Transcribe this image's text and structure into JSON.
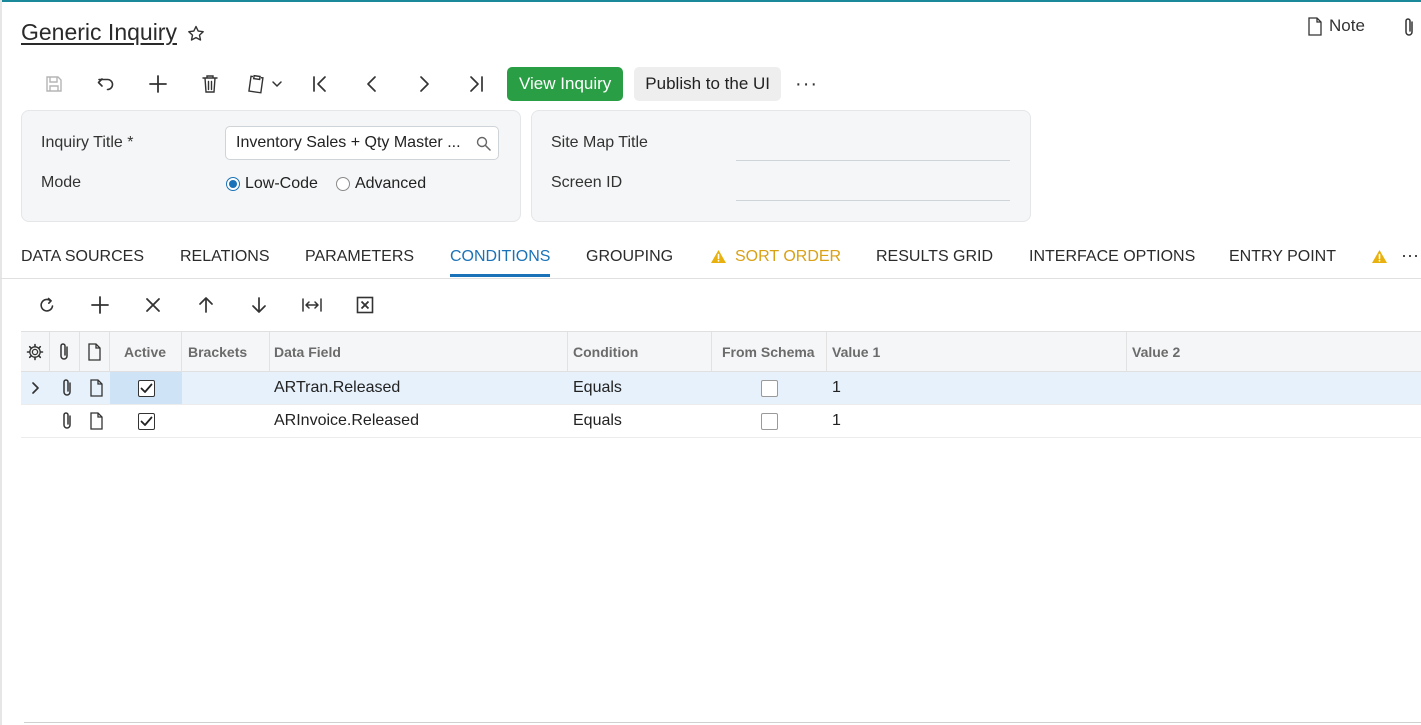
{
  "page": {
    "title": "Generic Inquiry",
    "note_label": "Note"
  },
  "toolbar": {
    "view_inquiry_label": "View Inquiry",
    "publish_label": "Publish to the UI",
    "more_label": "···"
  },
  "form": {
    "inquiry_title_label": "Inquiry Title *",
    "inquiry_title_value": "Inventory Sales + Qty Master ...",
    "mode_label": "Mode",
    "mode_options": [
      "Low-Code",
      "Advanced"
    ],
    "mode_selected": "Low-Code",
    "site_map_title_label": "Site Map Title",
    "site_map_title_value": "",
    "screen_id_label": "Screen ID",
    "screen_id_value": ""
  },
  "tabs": [
    {
      "label": "DATA SOURCES"
    },
    {
      "label": "RELATIONS"
    },
    {
      "label": "PARAMETERS"
    },
    {
      "label": "CONDITIONS",
      "active": true
    },
    {
      "label": "GROUPING"
    },
    {
      "label": "SORT ORDER",
      "warning": true
    },
    {
      "label": "RESULTS GRID"
    },
    {
      "label": "INTERFACE OPTIONS"
    },
    {
      "label": "ENTRY POINT"
    }
  ],
  "tabs_more": "···",
  "grid": {
    "columns": [
      "Active",
      "Brackets",
      "Data Field",
      "Condition",
      "From Schema",
      "Value 1",
      "Value 2"
    ],
    "rows": [
      {
        "active": true,
        "brackets": "",
        "data_field": "ARTran.Released",
        "condition": "Equals",
        "from_schema": false,
        "value1": "1",
        "value2": ""
      },
      {
        "active": true,
        "brackets": "",
        "data_field": "ARInvoice.Released",
        "condition": "Equals",
        "from_schema": false,
        "value1": "1",
        "value2": ""
      }
    ]
  },
  "colors": {
    "accent": "#1a73b8",
    "primary_button": "#2a9e45",
    "warning": "#d9a116"
  }
}
